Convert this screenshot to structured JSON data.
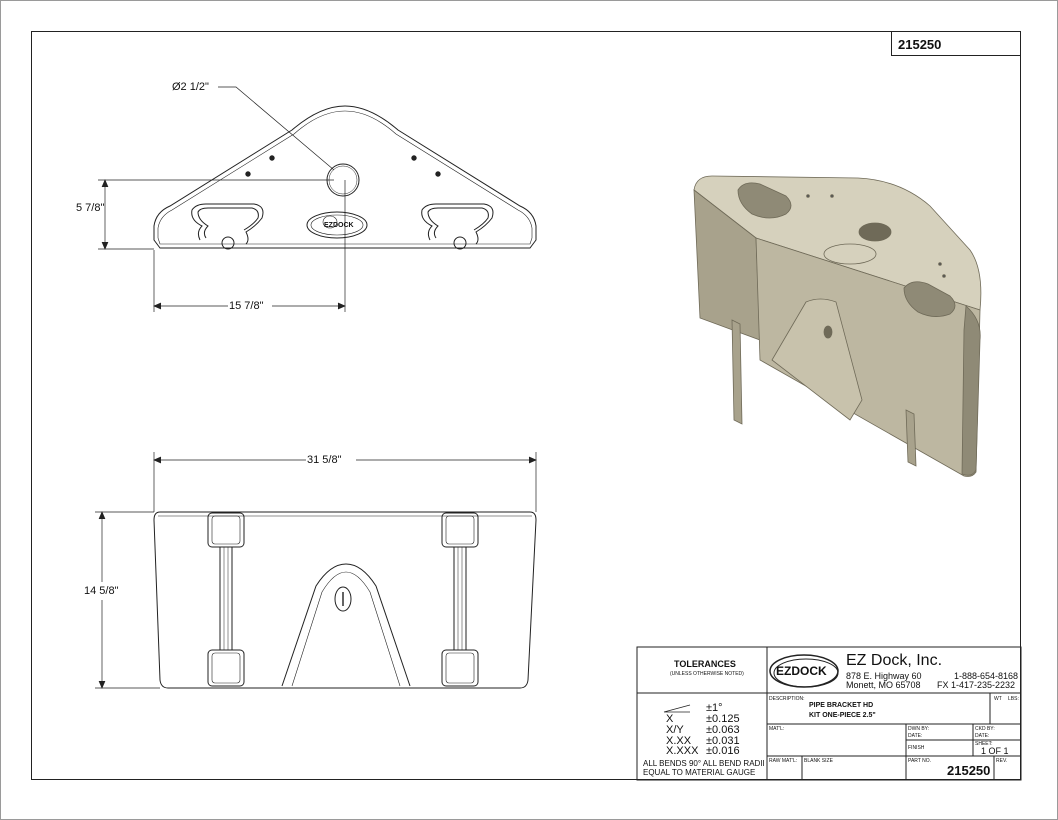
{
  "drawing": {
    "number_top": "215250",
    "number_bottom": "215250",
    "sheet": "1 OF 1"
  },
  "dimensions": {
    "diameter": "Ø2 1/2\"",
    "height_small": "5 7/8\"",
    "width_half": "15 7/8\"",
    "width_full": "31 5/8\"",
    "height_full": "14 5/8\""
  },
  "tolerances": {
    "title": "TOLERANCES",
    "subtitle": "(UNLESS OTHERWISE NOTED)",
    "angle": "±1°",
    "rows": [
      {
        "label": "X",
        "value": "±0.125"
      },
      {
        "label": "X/Y",
        "value": "±0.063"
      },
      {
        "label": "X.XX",
        "value": "±0.031"
      },
      {
        "label": "X.XXX",
        "value": "±0.016"
      }
    ],
    "note_line1": "ALL BENDS 90°   ALL BEND RADII",
    "note_line2": "EQUAL TO MATERIAL GAUGE"
  },
  "company": {
    "logo": "EZDOCK",
    "name": "EZ Dock, Inc.",
    "address1": "878 E. Highway 60",
    "address2": "Monett, MO 65708",
    "phone": "1-888-654-8168",
    "fax": "FX  1-417-235-2232"
  },
  "titleblock": {
    "description_label": "DESCRIPTION:",
    "description_line1": "PIPE BRACKET HD",
    "description_line2": "KIT ONE-PIECE 2.5\"",
    "wt_label": "WT",
    "lbs_label": "LBS:",
    "matl_label": "MAT'L:",
    "dwn_label": "DWN BY:",
    "date_label": "DATE:",
    "ckd_label": "CKD BY:",
    "ckd_date_label": "DATE:",
    "finish_label": "FINISH",
    "sheet_label": "SHEET:",
    "raw_label": "RAW MAT'L:",
    "blank_label": "BLANK SIZE",
    "part_label": "PART NO.",
    "rev_label": "REV."
  },
  "colors": {
    "line": "#222222",
    "render_face": "#bdb7a1",
    "render_top": "#d6d1bd",
    "render_dark": "#8f8a76"
  }
}
